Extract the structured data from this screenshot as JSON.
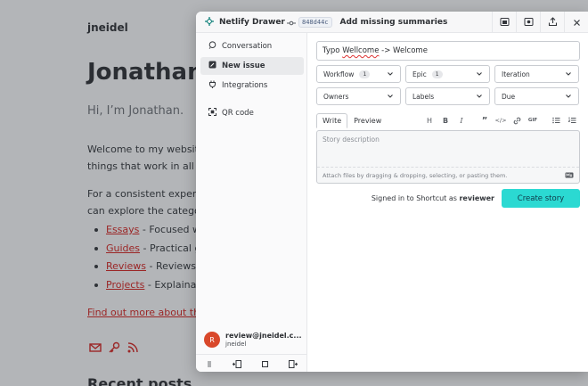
{
  "background_page": {
    "site_name": "jneidel",
    "heading": "Jonathan",
    "greeting": "Hi, I’m Jonathan.",
    "paragraph1_line1": "Welcome to my websit",
    "paragraph1_line2": "things that work in all a",
    "paragraph2_line1": "For a consistent experi",
    "paragraph2_line2": "can explore the catego",
    "list": [
      {
        "link": "Essays",
        "rest": " - Focused w"
      },
      {
        "link": "Guides",
        "rest": " - Practical g"
      },
      {
        "link": "Reviews",
        "rest": " - Reviews"
      },
      {
        "link": "Projects",
        "rest": " - Explainat"
      }
    ],
    "find_out_more": "Find out more about th",
    "recent_posts": "Recent posts"
  },
  "drawer": {
    "brand": "Netlify Drawer",
    "commit_hash": "848d44c",
    "commit_message": "Add missing summaries",
    "top_actions": [
      "screenshot-icon",
      "record-icon",
      "share-icon",
      "close-icon"
    ],
    "nav": [
      {
        "label": "Conversation",
        "icon": "chat-icon",
        "active": false
      },
      {
        "label": "New issue",
        "icon": "new-issue-icon",
        "active": true
      },
      {
        "label": "Integrations",
        "icon": "plug-icon",
        "active": false
      },
      {
        "label": "QR code",
        "icon": "qr-icon",
        "active": false
      }
    ],
    "account": {
      "avatar_letter": "R",
      "email": "review@jneidel.c...",
      "username": "jneidel",
      "avatar_color": "#d9482b"
    },
    "form": {
      "title_before": "Typo ",
      "title_misspelled": "Wellcome",
      "title_after": " -> Welcome",
      "selects_row1": [
        {
          "label": "Workflow",
          "badge": "1"
        },
        {
          "label": "Epic",
          "badge": "1"
        },
        {
          "label": "Iteration",
          "badge": null
        }
      ],
      "selects_row2": [
        {
          "label": "Owners"
        },
        {
          "label": "Labels"
        },
        {
          "label": "Due"
        }
      ],
      "tab_write": "Write",
      "tab_preview": "Preview",
      "toolbar": {
        "heading": "H",
        "bold": "B",
        "italic": "I",
        "quote": "”",
        "code": "</>",
        "gif": "GIF"
      },
      "description_placeholder": "Story description",
      "attach_hint": "Attach files by dragging & dropping, selecting, or pasting them.",
      "signed_in_prefix": "Signed in to Shortcut as ",
      "signed_in_user": "reviewer",
      "create_button": "Create story",
      "accent_color": "#2bd9d2"
    }
  }
}
